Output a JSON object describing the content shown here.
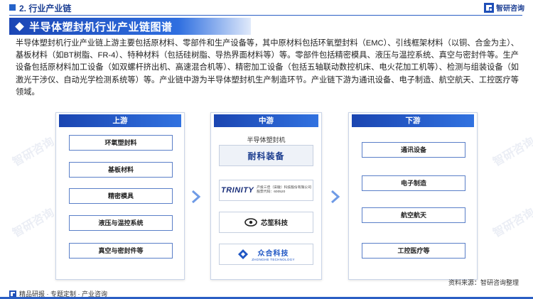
{
  "header": {
    "section_label": "2. 行业产业链",
    "brand_name": "智研咨询",
    "page_title": "半导体塑封机行业产业链图谱"
  },
  "intro_text": "半导体塑封机行业产业链上游主要包括原材料、零部件和生产设备等，其中原材料包括环氧塑封料（EMC）、引线框架材料（以铜、合金为主）、基板材料（如BT树脂、FR-4）、特种材料（包括硅树脂、导热界面材料等）等。零部件包括精密模具、液压与温控系统、真空与密封件等。生产设备包括原材料加工设备（如双螺杆挤出机、高速混合机等）、精密加工设备（包括五轴联动数控机床、电火花加工机等）、检测与组装设备（如激光干涉仪、自动光学检测系统等）等。产业链中游为半导体塑封机生产制造环节。产业链下游为通讯设备、电子制造、航空航天、工控医疗等领域。",
  "upstream": {
    "title": "上游",
    "items": [
      "环氧塑封料",
      "基板材料",
      "精密模具",
      "液压与温控系统",
      "真空与密封件等"
    ]
  },
  "midstream": {
    "title": "中游",
    "subtitle": "半导体塑封机",
    "companies": [
      {
        "name": "耐科装备"
      },
      {
        "logo_text": "TRINITY",
        "name": "产投三佳（安徽）科技股份有限公司",
        "code": "股票代码：600520"
      },
      {
        "name": "芯笙科技"
      },
      {
        "name": "众合科技",
        "en": "ZHONGHE TECHNOLOGY"
      }
    ]
  },
  "downstream": {
    "title": "下游",
    "items": [
      "通讯设备",
      "电子制造",
      "航空航天",
      "工控医疗等"
    ]
  },
  "footer": {
    "left_text": "精品研报 · 专题定制 · 产业咨询",
    "source_text": "资料来源：智研咨询整理"
  },
  "watermark_text": "智研咨询",
  "colors": {
    "primary_blue": "#1c3f94",
    "accent_blue": "#2f6fe0",
    "box_border": "#5a7fc8"
  }
}
